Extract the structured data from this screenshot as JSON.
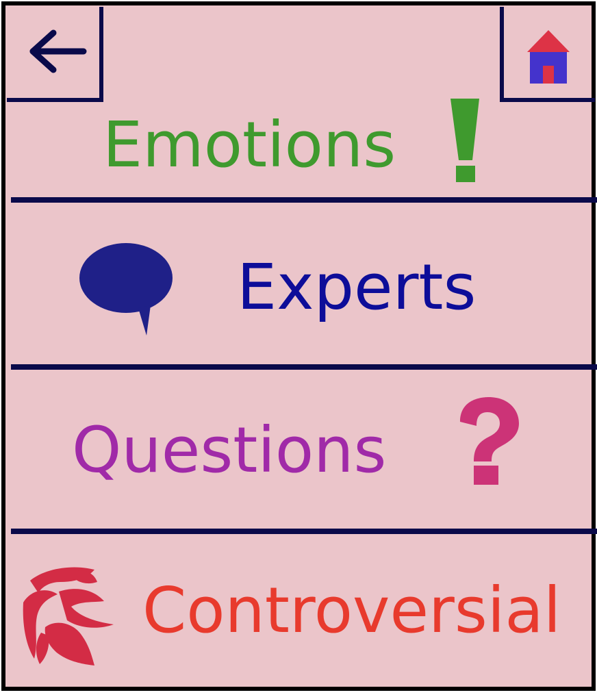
{
  "colors": {
    "background": "#ebc5ca",
    "border": "#0a0a4a",
    "emotions": "#3f9a2e",
    "experts": "#0d0d99",
    "questions": "#a02aa8",
    "question_icon": "#cc3377",
    "controversial": "#e83a2d",
    "controversial_icon": "#d32c45",
    "home_roof": "#dd3346",
    "home_body": "#4433cc"
  },
  "nav": {
    "back_icon": "left-arrow-icon",
    "home_icon": "house-icon"
  },
  "menu": {
    "items": [
      {
        "label": "Emotions",
        "icon": "exclamation-icon"
      },
      {
        "label": "Experts",
        "icon": "speech-bubble-icon"
      },
      {
        "label": "Questions",
        "icon": "question-mark-icon"
      },
      {
        "label": "Controversial",
        "icon": "scribble-icon"
      }
    ]
  }
}
